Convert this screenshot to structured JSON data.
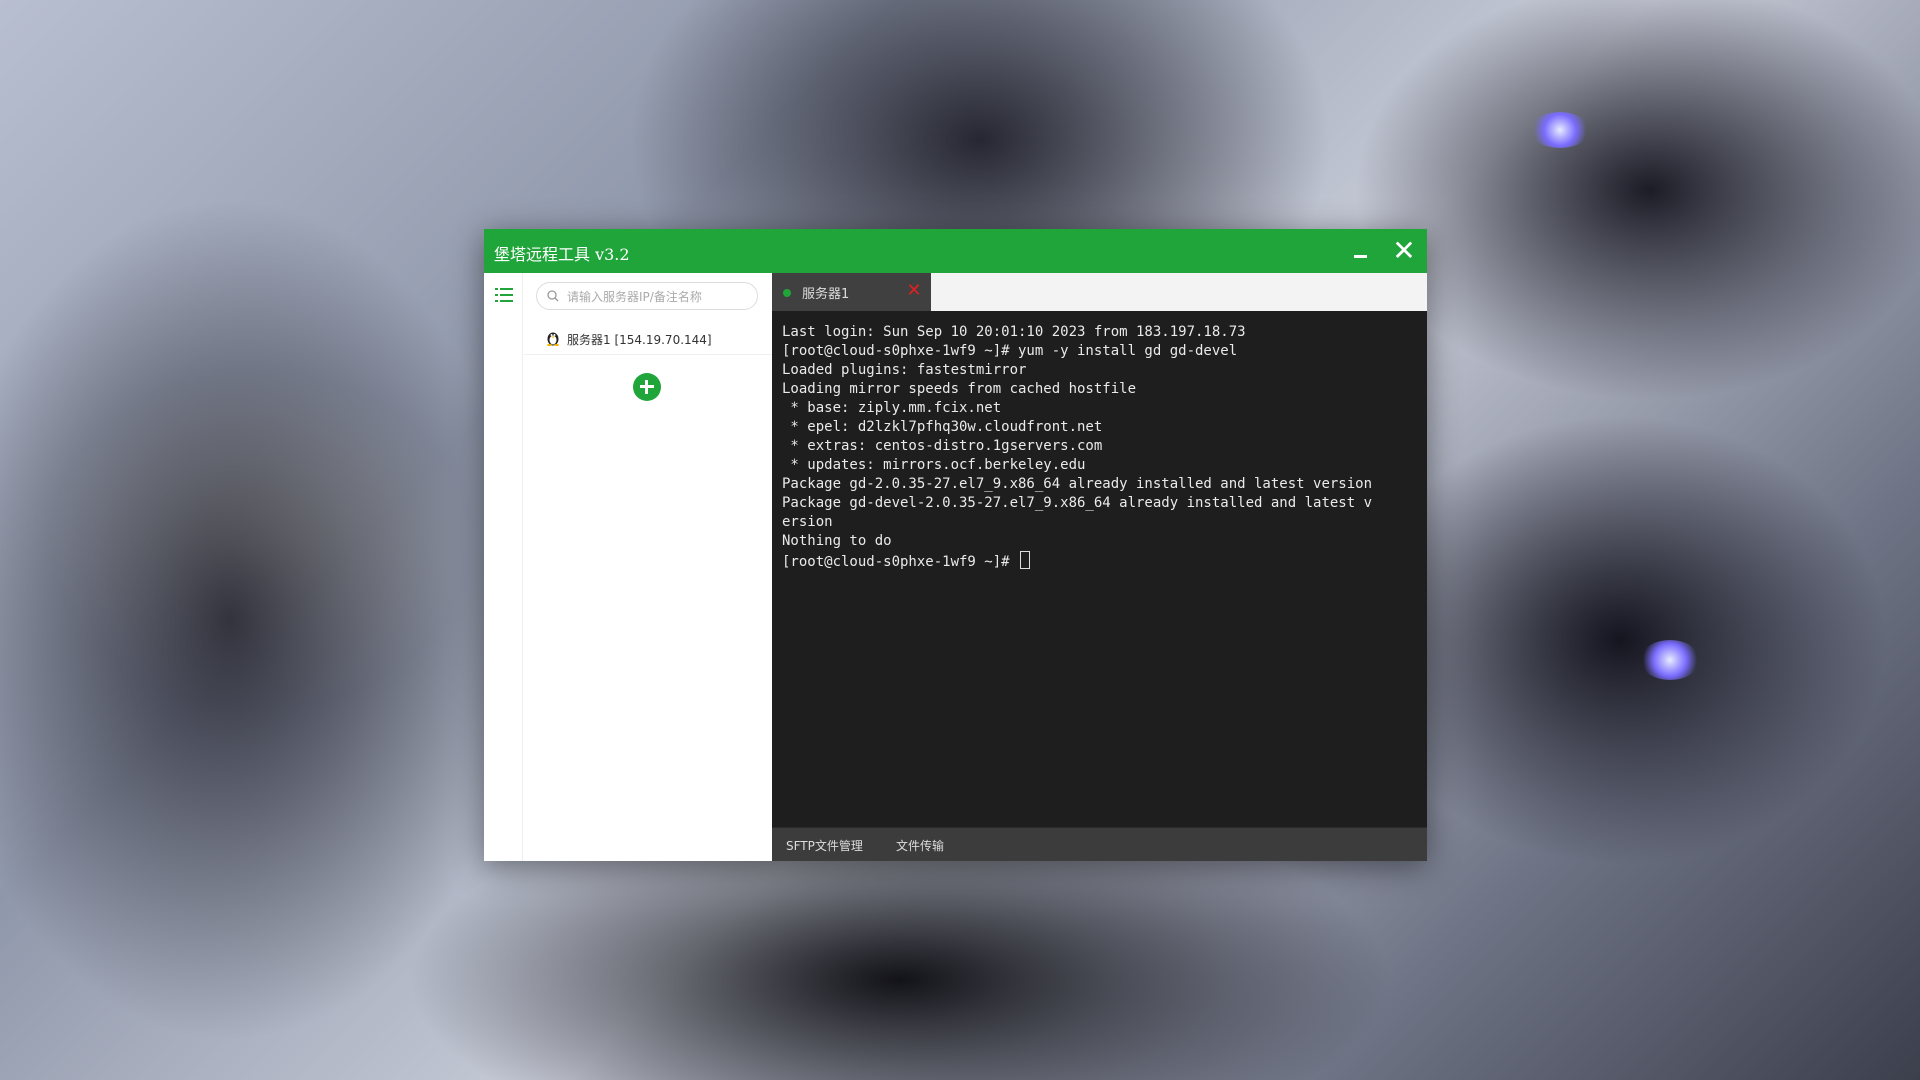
{
  "window": {
    "title": "堡塔远程工具 v3.2",
    "close_glyph": "✕"
  },
  "sidebar": {
    "search_placeholder": "请输入服务器IP/备注名称",
    "servers": [
      {
        "label": "服务器1 [154.19.70.144]",
        "os_icon": "linux-penguin-icon"
      }
    ]
  },
  "tabs": [
    {
      "label": "服务器1",
      "status": "connected",
      "close_glyph": "✕"
    }
  ],
  "terminal": {
    "lines": [
      "Last login: Sun Sep 10 20:01:10 2023 from 183.197.18.73",
      "[root@cloud-s0phxe-1wf9 ~]# yum -y install gd gd-devel",
      "Loaded plugins: fastestmirror",
      "Loading mirror speeds from cached hostfile",
      " * base: ziply.mm.fcix.net",
      " * epel: d2lzkl7pfhq30w.cloudfront.net",
      " * extras: centos-distro.1gservers.com",
      " * updates: mirrors.ocf.berkeley.edu",
      "Package gd-2.0.35-27.el7_9.x86_64 already installed and latest version",
      "Package gd-devel-2.0.35-27.el7_9.x86_64 already installed and latest v",
      "ersion",
      "Nothing to do"
    ],
    "prompt": "[root@cloud-s0phxe-1wf9 ~]# "
  },
  "bottombar": {
    "sftp_label": "SFTP文件管理",
    "transfer_label": "文件传输"
  },
  "colors": {
    "accent": "#20a53a",
    "terminal_bg": "#1e1e1e",
    "tab_close": "#e02020"
  }
}
